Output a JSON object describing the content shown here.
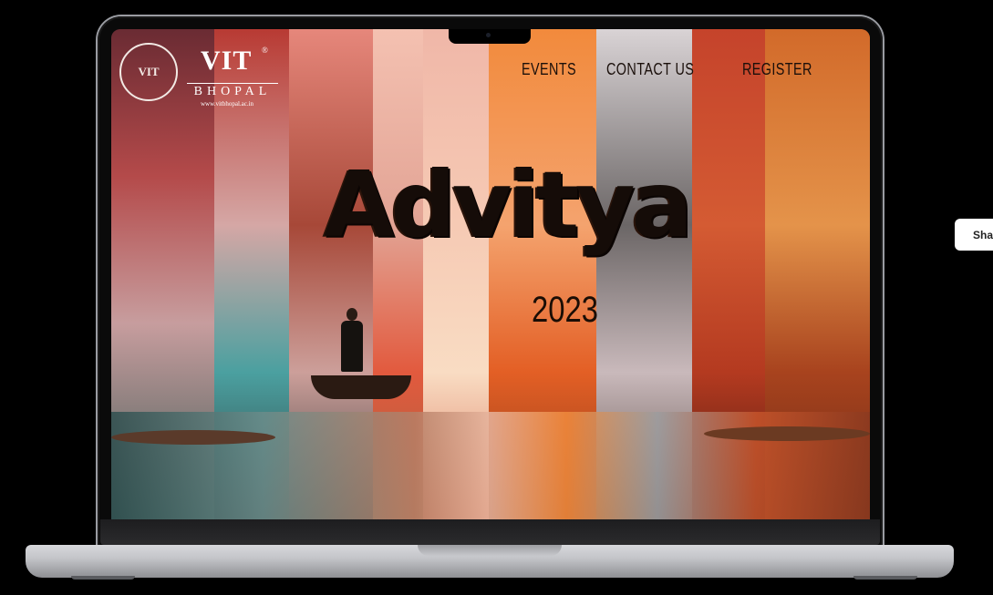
{
  "logo": {
    "title": "VIT",
    "registered_mark": "®",
    "subtitle": "BHOPAL",
    "url": "www.vitbhopal.ac.in",
    "seal_text": "VIT"
  },
  "nav": {
    "events": "EVENTS",
    "contact": "CONTACT US",
    "register": "REGISTER"
  },
  "hero": {
    "title": "Advitya",
    "year": "2023"
  },
  "share": {
    "label": "Sha"
  },
  "colors": {
    "background": "#000000",
    "title_text": "#150c08",
    "nav_text": "#1a0f0a"
  }
}
